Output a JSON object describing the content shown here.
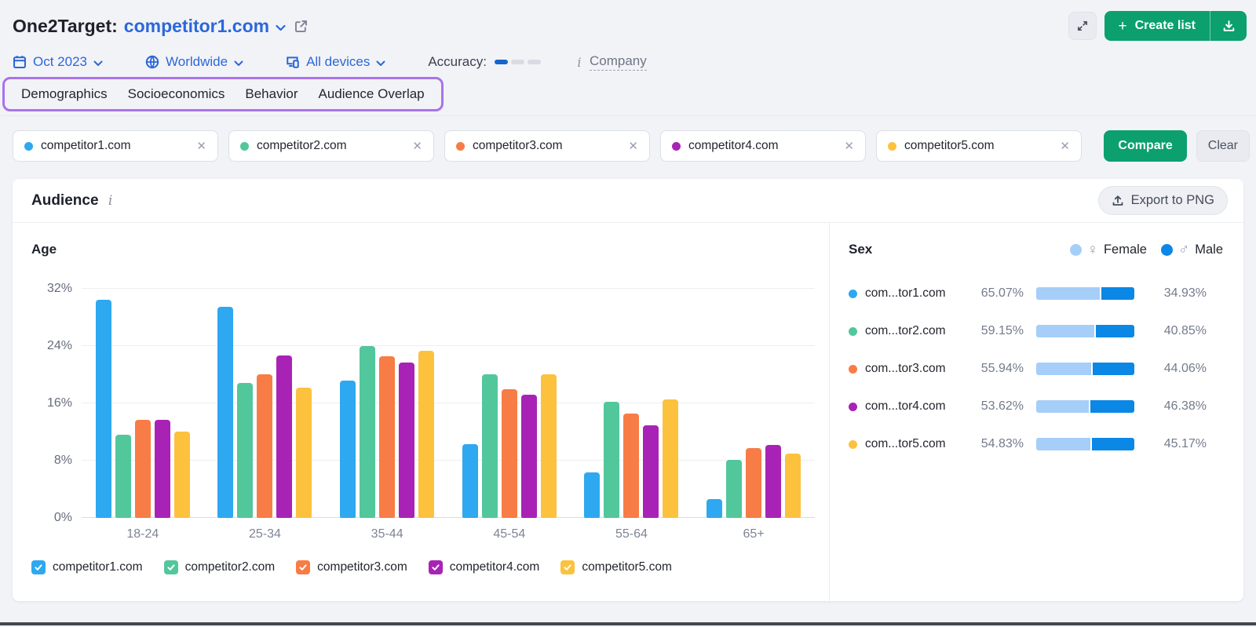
{
  "header": {
    "title": "One2Target:",
    "domain": "competitor1.com",
    "create_list_label": "Create list"
  },
  "filters": {
    "date": "Oct 2023",
    "location": "Worldwide",
    "devices": "All devices",
    "accuracy_label": "Accuracy:",
    "accuracy_filled": 1,
    "accuracy_total": 3,
    "accuracy_active_color": "#1565cc",
    "accuracy_inactive_color": "#d8dbe3",
    "company_link": "Company"
  },
  "tabs": [
    "Demographics",
    "Socioeconomics",
    "Behavior",
    "Audience Overlap"
  ],
  "competitors": [
    {
      "name": "competitor1.com",
      "color": "#2ea8f0"
    },
    {
      "name": "competitor2.com",
      "color": "#52c79c"
    },
    {
      "name": "competitor3.com",
      "color": "#f87c45"
    },
    {
      "name": "competitor4.com",
      "color": "#a823b5"
    },
    {
      "name": "competitor5.com",
      "color": "#fcc23e"
    }
  ],
  "toolbar": {
    "compare_label": "Compare",
    "clear_label": "Clear"
  },
  "audience": {
    "title": "Audience",
    "export_label": "Export to PNG"
  },
  "icons": {
    "plus": "+",
    "close": "✕",
    "female": "♀",
    "male": "♂",
    "info": "i"
  },
  "colors": {
    "accent_blue": "#2b67d9",
    "green": "#0ba06e",
    "annotation_purple": "#a873ea",
    "female": "#a5cef8",
    "male": "#0b87e6"
  },
  "chart_data": [
    {
      "type": "bar",
      "title": "Age",
      "categories": [
        "18-24",
        "25-34",
        "35-44",
        "45-54",
        "55-64",
        "65+"
      ],
      "series": [
        {
          "name": "competitor1.com",
          "color": "#2ea8f0",
          "values": [
            30.5,
            29.5,
            19.2,
            10.3,
            6.4,
            2.6
          ]
        },
        {
          "name": "competitor2.com",
          "color": "#52c79c",
          "values": [
            11.6,
            18.9,
            24.0,
            20.0,
            16.2,
            8.1
          ]
        },
        {
          "name": "competitor3.com",
          "color": "#f87c45",
          "values": [
            13.7,
            20.0,
            22.6,
            18.0,
            14.6,
            9.8
          ]
        },
        {
          "name": "competitor4.com",
          "color": "#a823b5",
          "values": [
            13.7,
            22.7,
            21.7,
            17.2,
            12.9,
            10.2
          ]
        },
        {
          "name": "competitor5.com",
          "color": "#fcc23e",
          "values": [
            12.1,
            18.2,
            23.3,
            20.0,
            16.5,
            9.0
          ]
        }
      ],
      "xlabel": "",
      "ylabel": "",
      "ylim": [
        0,
        32
      ],
      "yticks": [
        0,
        8,
        16,
        24,
        32
      ],
      "grid": true,
      "legend_position": "bottom"
    },
    {
      "type": "bar",
      "subtype": "horizontal-stacked",
      "title": "Sex",
      "legend": [
        {
          "label": "Female",
          "color": "#a5cef8"
        },
        {
          "label": "Male",
          "color": "#0b87e6"
        }
      ],
      "rows": [
        {
          "name": "com...tor1.com",
          "dot_color": "#2ea8f0",
          "female": 65.07,
          "male": 34.93
        },
        {
          "name": "com...tor2.com",
          "dot_color": "#52c79c",
          "female": 59.15,
          "male": 40.85
        },
        {
          "name": "com...tor3.com",
          "dot_color": "#f87c45",
          "female": 55.94,
          "male": 44.06
        },
        {
          "name": "com...tor4.com",
          "dot_color": "#a823b5",
          "female": 53.62,
          "male": 46.38
        },
        {
          "name": "com...tor5.com",
          "dot_color": "#fcc23e",
          "female": 54.83,
          "male": 45.17
        }
      ]
    }
  ]
}
